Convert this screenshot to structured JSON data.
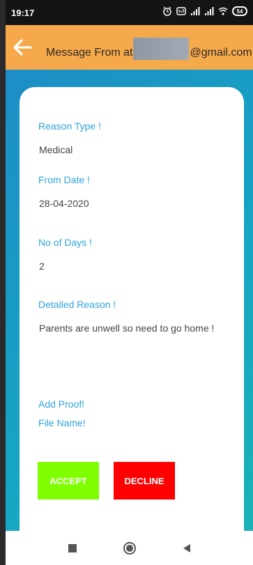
{
  "status_bar": {
    "time": "19:17",
    "battery": "54"
  },
  "app_bar": {
    "title_prefix": "Message From at",
    "title_suffix": "@gmail.com"
  },
  "leave": {
    "reason_type_label": "Reason Type !",
    "reason_type_value": "Medical",
    "from_date_label": "From Date !",
    "from_date_value": "28-04-2020",
    "days_label": "No of Days !",
    "days_value": "2",
    "detail_label": "Detailed Reason !",
    "detail_value": "Parents are unwell so need to go home !",
    "proof_label": "Add Proof!",
    "file_label": "File Name!"
  },
  "actions": {
    "accept": "ACCEPT",
    "decline": "DECLINE"
  },
  "colors": {
    "app_bar": "#f6a94a",
    "label": "#2ea3d9",
    "accept": "#7fff00",
    "decline": "#ff0000"
  },
  "icons": {
    "back": "arrow-left-icon",
    "nav_recent": "square-icon",
    "nav_home": "circle-icon",
    "nav_back": "triangle-left-icon"
  }
}
